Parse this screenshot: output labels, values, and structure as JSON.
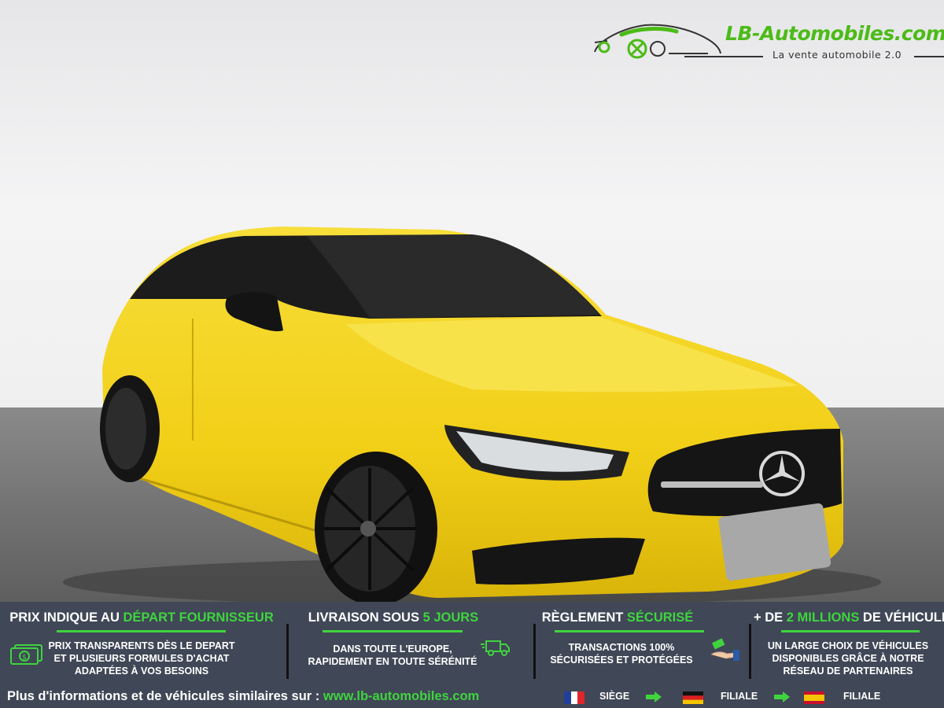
{
  "logo": {
    "name": "LB-Automobiles.com",
    "tagline": "La vente automobile 2.0"
  },
  "photo": {
    "subject": "yellow-car-photo",
    "car_color": "#f2d21e",
    "bg_color": "#f2f2f2",
    "floor_color": "#6f6f6f"
  },
  "band": {
    "columns": [
      {
        "title_pre": "PRIX INDIQUE AU ",
        "title_hl": "DÉPART FOURNISSEUR",
        "title_post": "",
        "text": [
          "PRIX TRANSPARENTS DÈS LE DEPART",
          "ET PLUSIEURS FORMULES D'ACHAT",
          "ADAPTÉES À VOS BESOINS"
        ],
        "icon": "money-icon"
      },
      {
        "title_pre": "LIVRAISON SOUS ",
        "title_hl": "5 JOURS",
        "title_post": "",
        "text": [
          "DANS TOUTE L'EUROPE,",
          "RAPIDEMENT EN TOUTE SÉRÉNITÉ"
        ],
        "icon": "truck-icon"
      },
      {
        "title_pre": "RÈGLEMENT ",
        "title_hl": "SÉCURISÉ",
        "title_post": "",
        "text": [
          "TRANSACTIONS 100%",
          "SÉCURISÉES ET PROTÉGÉES"
        ],
        "icon": "payment-hand-icon"
      },
      {
        "title_pre": "+ DE ",
        "title_hl": "2 MILLIONS",
        "title_post": " DE VÉHICULES",
        "text": [
          "UN LARGE CHOIX DE VÉHICULES",
          "DISPONIBLES GRÂCE À NOTRE",
          "RÉSEAU DE PARTENAIRES"
        ],
        "icon": ""
      }
    ],
    "accent_color": "#3fd43f",
    "bg_color": "#404756"
  },
  "footer": {
    "text": "Plus d'informations et de véhicules similaires sur : ",
    "link": "www.lb-automobiles.com",
    "locations": [
      {
        "flag": "france-flag-icon",
        "label": "SIÈGE"
      },
      {
        "flag": "germany-flag-icon",
        "label": "FILIALE"
      },
      {
        "flag": "spain-flag-icon",
        "label": "FILIALE"
      }
    ]
  }
}
